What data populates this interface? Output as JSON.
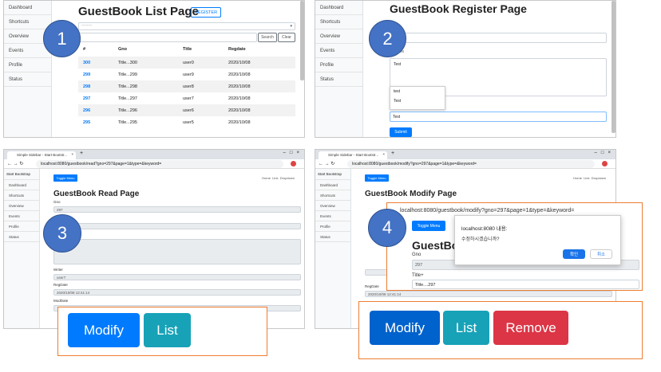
{
  "sidebar": {
    "brand": "Start Bootstrap",
    "items": [
      "Dashboard",
      "Shortcuts",
      "Overview",
      "Events",
      "Profile",
      "Status"
    ]
  },
  "panel1": {
    "title": "GuestBook List Page",
    "register_label": "REGISTER",
    "select_placeholder": "--------",
    "search_label": "Search",
    "clear_label": "Clear",
    "columns": [
      "#",
      "Gno",
      "Title",
      "Regdate"
    ],
    "rows": [
      {
        "no": "300",
        "gno": "Title...300",
        "title": "user0",
        "regdate": "2020/10/08"
      },
      {
        "no": "299",
        "gno": "Title...299",
        "title": "user9",
        "regdate": "2020/10/08"
      },
      {
        "no": "298",
        "gno": "Title...298",
        "title": "user8",
        "regdate": "2020/10/08"
      },
      {
        "no": "297",
        "gno": "Title...297",
        "title": "user7",
        "regdate": "2020/10/08"
      },
      {
        "no": "296",
        "gno": "Title...296",
        "title": "user6",
        "regdate": "2020/10/08"
      },
      {
        "no": "295",
        "gno": "Title...295",
        "title": "user5",
        "regdate": "2020/10/08"
      }
    ]
  },
  "panel2": {
    "title": "GuestBook Register Page",
    "content_label": "Content",
    "content_value": "Test",
    "autocomplete": [
      "test",
      "Test"
    ],
    "writer_value": "Test",
    "submit_label": "Submit"
  },
  "panel3": {
    "tab_title": "Simple Sidebar - Start Bootstr...",
    "url": "localhost:8080/guestbook/read?gno=297&page=1&type=&keyword=",
    "toggle_label": "Toggle Menu",
    "nav": [
      "Home",
      "Link",
      "Dropdown"
    ],
    "title": "GuestBook Read Page",
    "gno_label": "Gno",
    "gno_value": "297",
    "writer_label": "Writer",
    "writer_value": "user7",
    "regdate_label": "RegDate",
    "regdate_value": "2020/10/08 12:41:14",
    "moddate_label": "ModDate",
    "modify_label": "Modify",
    "list_label": "List"
  },
  "panel4": {
    "tab_title": "Simple Sidebar - Start Bootstr...",
    "url": "localhost:8080/guestbook/modify?gno=297&page=1&type=&keyword=",
    "toggle_label": "Toggle Menu",
    "nav": [
      "Home",
      "Link",
      "Dropdown"
    ],
    "title": "GuestBook Modify Page",
    "dialog_url": "localhost:8080/guestbook/modify?gno=297&page=1&type=&keyword=",
    "dialog_origin": "localhost:8080 내용:",
    "dialog_message": "수정하시겠습니까?",
    "confirm_label": "확인",
    "cancel_label": "취소",
    "zoom_title": "GuestBo",
    "gno_label": "Gno",
    "gno_value": "297",
    "title_label": "Title+",
    "title_value": "Title....297",
    "regdate_label": "RegDate",
    "regdate_value": "2020/10/08 12:41:14",
    "modify_label": "Modify",
    "list_label": "List",
    "remove_label": "Remove"
  },
  "markers": [
    "1",
    "2",
    "3",
    "4"
  ],
  "colors": {
    "primary": "#007bff",
    "info": "#17a2b8",
    "danger": "#dc3545",
    "marker": "#4472c4",
    "highlight_border": "#ed7d31"
  }
}
